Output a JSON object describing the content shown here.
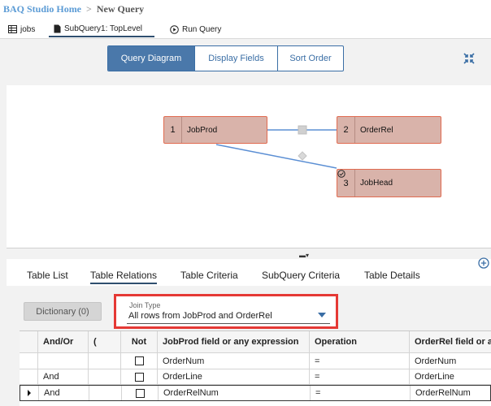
{
  "breadcrumb": {
    "home": "BAQ Studio Home",
    "separator": ">",
    "current": "New Query"
  },
  "top_tabs": [
    {
      "label": "jobs",
      "icon": "table-icon"
    },
    {
      "label": "SubQuery1: TopLevel",
      "icon": "document-icon",
      "active": true
    },
    {
      "label": "Run Query",
      "icon": "play-circle-icon"
    }
  ],
  "view_buttons": [
    {
      "label": "Query Diagram",
      "active": true
    },
    {
      "label": "Display Fields",
      "active": false
    },
    {
      "label": "Sort Order",
      "active": false
    }
  ],
  "diagram": {
    "tables": [
      {
        "number": "1",
        "name": "JobProd"
      },
      {
        "number": "2",
        "name": "OrderRel"
      },
      {
        "number": "3",
        "name": "JobHead",
        "icon": "check-circle-icon"
      }
    ],
    "colors": {
      "node_fill": "#d9b3aa",
      "node_border": "#e06b50",
      "link": "#5b8fd4"
    }
  },
  "panel_tabs": [
    {
      "label": "Table List",
      "active": false
    },
    {
      "label": "Table Relations",
      "active": true
    },
    {
      "label": "Table Criteria",
      "active": false
    },
    {
      "label": "SubQuery Criteria",
      "active": false
    },
    {
      "label": "Table Details",
      "active": false
    }
  ],
  "dictionary_button": "Dictionary (0)",
  "join_type": {
    "label": "Join Type",
    "value": "All rows from JobProd and OrderRel"
  },
  "relations_grid": {
    "columns": [
      "And/Or",
      "(",
      "Not",
      "JobProd field or any expression",
      "Operation",
      "OrderRel field or an"
    ],
    "rows": [
      {
        "and_or": "",
        "open_paren": "",
        "not": false,
        "left_field": "OrderNum",
        "operation": "=",
        "right_field": "OrderNum"
      },
      {
        "and_or": "And",
        "open_paren": "",
        "not": false,
        "left_field": "OrderLine",
        "operation": "=",
        "right_field": "OrderLine"
      },
      {
        "and_or": "And",
        "open_paren": "",
        "not": false,
        "left_field": "OrderRelNum",
        "operation": "=",
        "right_field": "OrderRelNum",
        "current": true
      }
    ]
  },
  "accent_color": "#4a78aa",
  "highlight_color": "#e53935"
}
